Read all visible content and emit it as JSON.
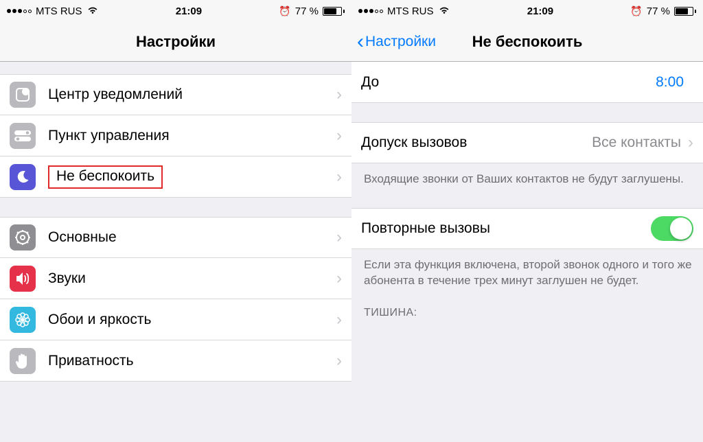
{
  "status": {
    "carrier": "MTS RUS",
    "time": "21:09",
    "battery_text": "77 %"
  },
  "left": {
    "title": "Настройки",
    "group1": [
      {
        "label": "Центр уведомлений",
        "icon": "notif"
      },
      {
        "label": "Пункт управления",
        "icon": "control"
      },
      {
        "label": "Не беспокоить",
        "icon": "dnd",
        "highlighted": true
      }
    ],
    "group2": [
      {
        "label": "Основные",
        "icon": "general"
      },
      {
        "label": "Звуки",
        "icon": "sounds"
      },
      {
        "label": "Обои и яркость",
        "icon": "wall"
      },
      {
        "label": "Приватность",
        "icon": "privacy"
      }
    ]
  },
  "right": {
    "back_label": "Настройки",
    "title": "Не беспокоить",
    "row_until": {
      "label": "До",
      "value": "8:00"
    },
    "row_allow": {
      "label": "Допуск вызовов",
      "value": "Все контакты"
    },
    "allow_footer": "Входящие звонки от Ваших контактов не будут заглушены.",
    "row_repeat": {
      "label": "Повторные вызовы",
      "on": true
    },
    "repeat_footer": "Если эта функция включена, второй звонок одного и того же абонента в течение трех минут заглушен не будет.",
    "silence_header": "ТИШИНА:"
  }
}
